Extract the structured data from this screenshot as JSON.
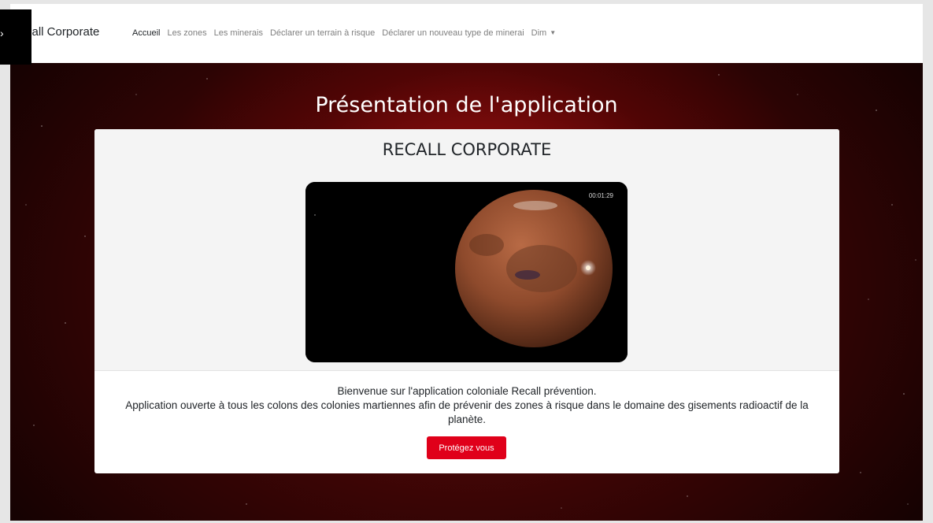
{
  "navbar": {
    "brand": "call Corporate",
    "items": [
      {
        "label": "Accueil",
        "active": true
      },
      {
        "label": "Les zones"
      },
      {
        "label": "Les minerais"
      },
      {
        "label": "Déclarer un terrain à risque"
      },
      {
        "label": "Déclarer un nouveau type de minerai"
      },
      {
        "label": "Dim"
      }
    ],
    "dropdown_icon": "caret-down-icon"
  },
  "hero": {
    "title": "Présentation de l'application"
  },
  "card": {
    "title": "RECALL CORPORATE",
    "video": {
      "timestamp": "00:01:29",
      "subject": "mars-planet"
    },
    "text_line1": "Bienvenue sur l'application coloniale Recall prévention.",
    "text_line2": "Application ouverte à tous les colons des colonies martiennes afin de prévenir des zones à risque dans le domaine des gisements radioactif de la planète.",
    "button_label": "Protégez vous"
  },
  "colors": {
    "accent": "#e0001a",
    "background_dark_red": "#3a0505"
  }
}
